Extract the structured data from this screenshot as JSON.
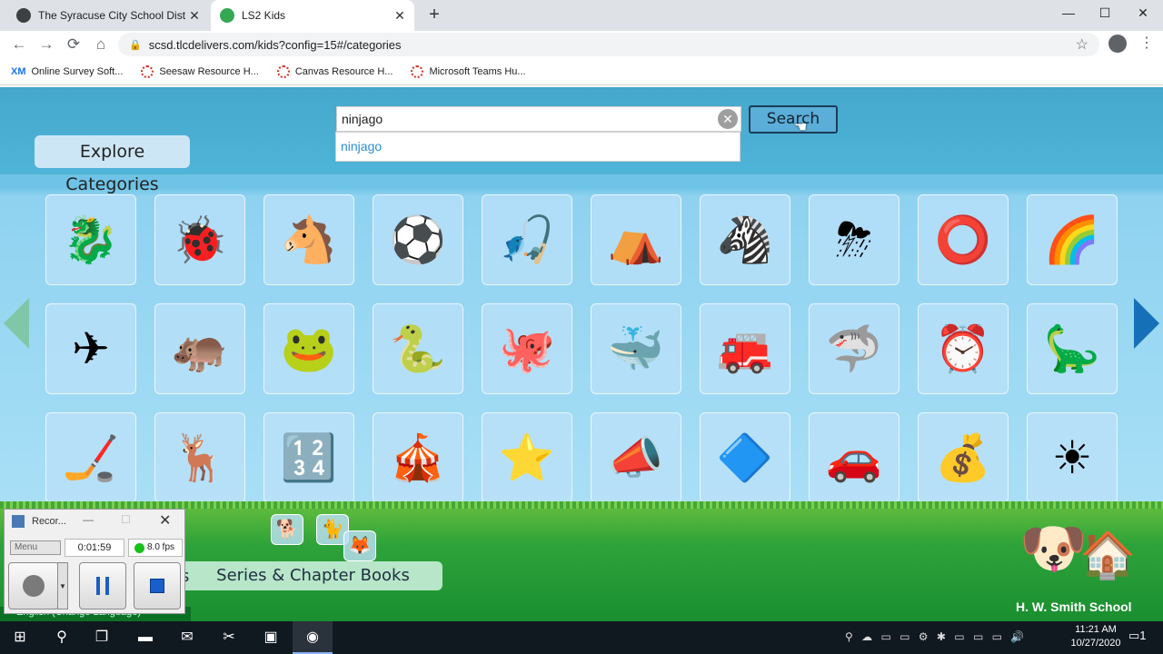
{
  "browser": {
    "tabs": [
      {
        "title": "The Syracuse City School District",
        "favicon_color": "#3c4043",
        "close": "✕"
      },
      {
        "title": "LS2 Kids",
        "favicon_color": "#34a853",
        "close": "✕"
      }
    ],
    "new_tab": "+",
    "window_controls": {
      "minimize": "—",
      "maximize": "☐",
      "close": "✕"
    },
    "nav": {
      "back": "←",
      "forward": "→",
      "reload": "⟳",
      "home": "⌂"
    },
    "url": "scsd.tlcdelivers.com/kids?config=15#/categories",
    "lock": "🔒",
    "star": "☆",
    "menu": "⋮",
    "bookmarks": [
      {
        "label": "Online Survey Soft...",
        "icon": "XM"
      },
      {
        "label": "Seesaw Resource H...",
        "icon": "dotted-circle"
      },
      {
        "label": "Canvas Resource H...",
        "icon": "dotted-circle"
      },
      {
        "label": "Microsoft Teams Hu...",
        "icon": "dotted-circle"
      }
    ]
  },
  "page": {
    "search_value": "ninjago",
    "search_clear": "✕",
    "suggestion": "ninjago",
    "search_button": "Search",
    "explore_button": "Explore Categories",
    "series_button": "Series & Chapter Books",
    "series_fragment": "s",
    "school_name": "H. W. Smith School",
    "bottom_fragment": "English (Change Language)",
    "tiles": [
      [
        "🐉",
        "🐞",
        "🐴",
        "⚽",
        "🎣",
        "⛺",
        "🦓",
        "⛈",
        "⭕",
        "🌈"
      ],
      [
        "✈",
        "🦛",
        "🐸",
        "🐍",
        "🐙",
        "🐳",
        "🚒",
        "🦈",
        "⏰",
        "🦕"
      ],
      [
        "🏒",
        "🦌",
        "🔢",
        "🎪",
        "⭐",
        "📣",
        "🔷",
        "🚗",
        "💰",
        "☀"
      ]
    ],
    "mini_tiles": [
      "🐕",
      "🐈",
      "🦊"
    ]
  },
  "recorder": {
    "title": "Recor...",
    "menu": "Menu",
    "time": "0:01:59",
    "fps": "8.0 fps",
    "min": "—",
    "max": "☐",
    "close": "✕"
  },
  "taskbar": {
    "time": "11:21 AM",
    "date": "10/27/2020",
    "icons": [
      "windows-icon",
      "search-icon",
      "taskview-icon",
      "explorer-icon",
      "outlook-icon",
      "snip-icon",
      "app-icon",
      "chrome-icon"
    ],
    "tray": "⚲ ☁ ▭ ▭ ⚙ ✱ ▭ ▭ ▭ 🔊",
    "notification_count": "1"
  }
}
